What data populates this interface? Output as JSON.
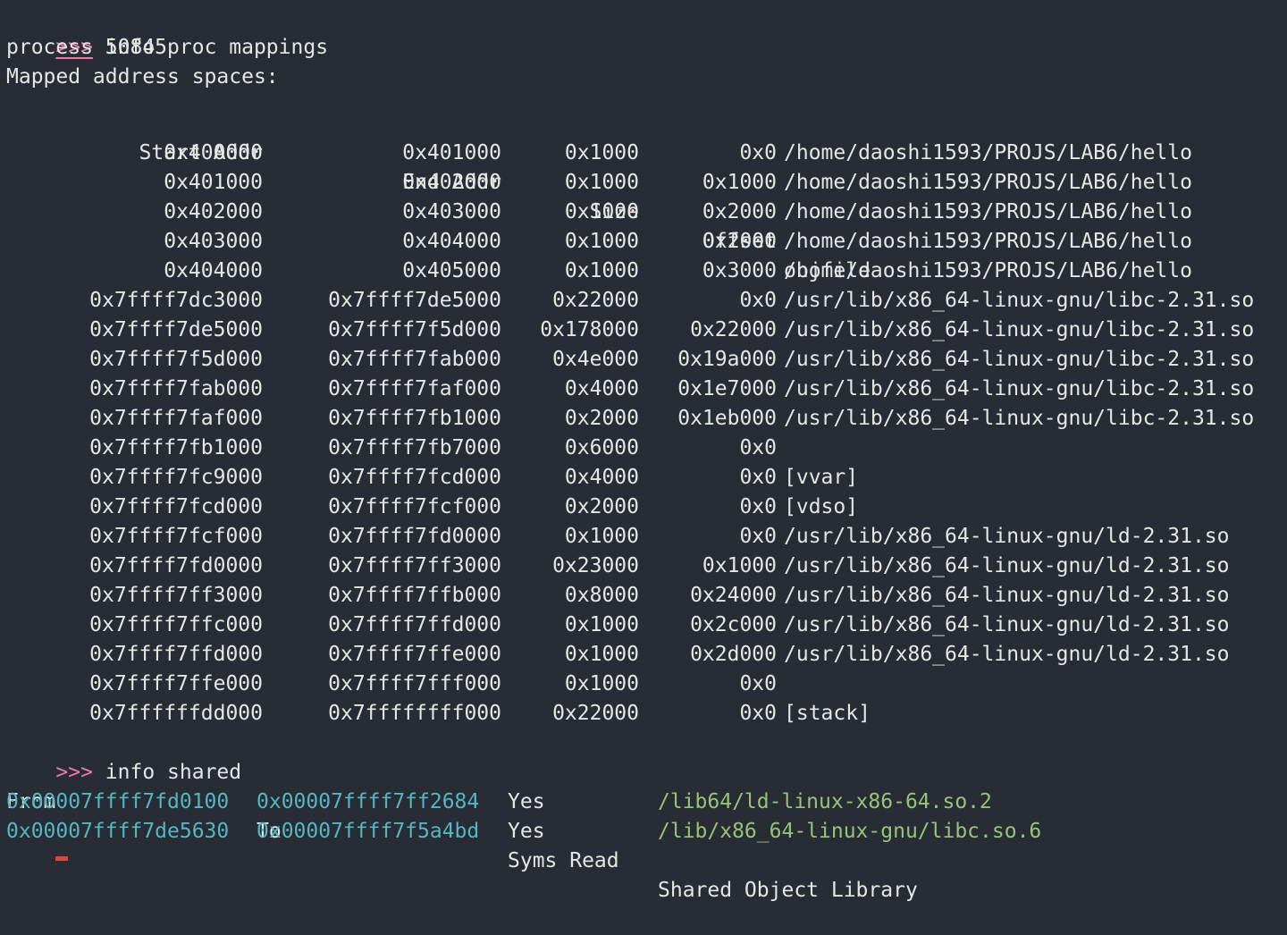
{
  "commands": [
    {
      "prompt": ">>>",
      "text": "info proc mappings"
    },
    {
      "prompt": ">>>",
      "text": "info shared"
    }
  ],
  "proc_header": {
    "process_line": "process 50845",
    "mapped_line": "Mapped address spaces:"
  },
  "mappings": {
    "headers": {
      "start": "Start Addr",
      "end": "End Addr",
      "size": "Size",
      "offset": "Offset",
      "objfile": "objfile"
    },
    "rows": [
      {
        "start": "0x400000",
        "end": "0x401000",
        "size": "0x1000",
        "offset": "0x0",
        "objfile": "/home/daoshi1593/PROJS/LAB6/hello"
      },
      {
        "start": "0x401000",
        "end": "0x402000",
        "size": "0x1000",
        "offset": "0x1000",
        "objfile": "/home/daoshi1593/PROJS/LAB6/hello"
      },
      {
        "start": "0x402000",
        "end": "0x403000",
        "size": "0x1000",
        "offset": "0x2000",
        "objfile": "/home/daoshi1593/PROJS/LAB6/hello"
      },
      {
        "start": "0x403000",
        "end": "0x404000",
        "size": "0x1000",
        "offset": "0x2000",
        "objfile": "/home/daoshi1593/PROJS/LAB6/hello"
      },
      {
        "start": "0x404000",
        "end": "0x405000",
        "size": "0x1000",
        "offset": "0x3000",
        "objfile": "/home/daoshi1593/PROJS/LAB6/hello"
      },
      {
        "start": "0x7ffff7dc3000",
        "end": "0x7ffff7de5000",
        "size": "0x22000",
        "offset": "0x0",
        "objfile": "/usr/lib/x86_64-linux-gnu/libc-2.31.so"
      },
      {
        "start": "0x7ffff7de5000",
        "end": "0x7ffff7f5d000",
        "size": "0x178000",
        "offset": "0x22000",
        "objfile": "/usr/lib/x86_64-linux-gnu/libc-2.31.so"
      },
      {
        "start": "0x7ffff7f5d000",
        "end": "0x7ffff7fab000",
        "size": "0x4e000",
        "offset": "0x19a000",
        "objfile": "/usr/lib/x86_64-linux-gnu/libc-2.31.so"
      },
      {
        "start": "0x7ffff7fab000",
        "end": "0x7ffff7faf000",
        "size": "0x4000",
        "offset": "0x1e7000",
        "objfile": "/usr/lib/x86_64-linux-gnu/libc-2.31.so"
      },
      {
        "start": "0x7ffff7faf000",
        "end": "0x7ffff7fb1000",
        "size": "0x2000",
        "offset": "0x1eb000",
        "objfile": "/usr/lib/x86_64-linux-gnu/libc-2.31.so"
      },
      {
        "start": "0x7ffff7fb1000",
        "end": "0x7ffff7fb7000",
        "size": "0x6000",
        "offset": "0x0",
        "objfile": ""
      },
      {
        "start": "0x7ffff7fc9000",
        "end": "0x7ffff7fcd000",
        "size": "0x4000",
        "offset": "0x0",
        "objfile": "[vvar]"
      },
      {
        "start": "0x7ffff7fcd000",
        "end": "0x7ffff7fcf000",
        "size": "0x2000",
        "offset": "0x0",
        "objfile": "[vdso]"
      },
      {
        "start": "0x7ffff7fcf000",
        "end": "0x7ffff7fd0000",
        "size": "0x1000",
        "offset": "0x0",
        "objfile": "/usr/lib/x86_64-linux-gnu/ld-2.31.so"
      },
      {
        "start": "0x7ffff7fd0000",
        "end": "0x7ffff7ff3000",
        "size": "0x23000",
        "offset": "0x1000",
        "objfile": "/usr/lib/x86_64-linux-gnu/ld-2.31.so"
      },
      {
        "start": "0x7ffff7ff3000",
        "end": "0x7ffff7ffb000",
        "size": "0x8000",
        "offset": "0x24000",
        "objfile": "/usr/lib/x86_64-linux-gnu/ld-2.31.so"
      },
      {
        "start": "0x7ffff7ffc000",
        "end": "0x7ffff7ffd000",
        "size": "0x1000",
        "offset": "0x2c000",
        "objfile": "/usr/lib/x86_64-linux-gnu/ld-2.31.so"
      },
      {
        "start": "0x7ffff7ffd000",
        "end": "0x7ffff7ffe000",
        "size": "0x1000",
        "offset": "0x2d000",
        "objfile": "/usr/lib/x86_64-linux-gnu/ld-2.31.so"
      },
      {
        "start": "0x7ffff7ffe000",
        "end": "0x7ffff7fff000",
        "size": "0x1000",
        "offset": "0x0",
        "objfile": ""
      },
      {
        "start": "0x7ffffffdd000",
        "end": "0x7ffffffff000",
        "size": "0x22000",
        "offset": "0x0",
        "objfile": "[stack]"
      }
    ]
  },
  "shared": {
    "headers": {
      "from": "From",
      "to": "To",
      "syms": "Syms Read",
      "lib": "Shared Object Library"
    },
    "rows": [
      {
        "from": "0x00007ffff7fd0100",
        "to": "0x00007ffff7ff2684",
        "syms": "Yes",
        "lib": "/lib64/ld-linux-x86-64.so.2"
      },
      {
        "from": "0x00007ffff7de5630",
        "to": "0x00007ffff7f5a4bd",
        "syms": "Yes",
        "lib": "/lib/x86_64-linux-gnu/libc.so.6"
      }
    ]
  },
  "colors": {
    "background": "#282c34",
    "prompt": "#f07aa5",
    "address": "#56b6c2",
    "library_path": "#98c379"
  }
}
